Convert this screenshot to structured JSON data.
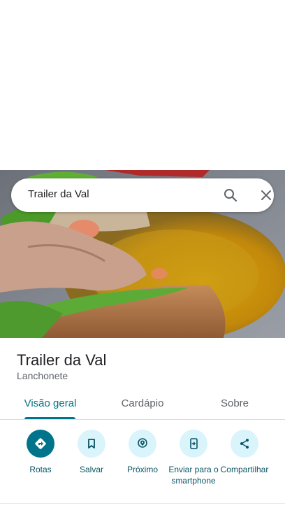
{
  "search": {
    "query": "Trailer da Val"
  },
  "icons": {
    "search": "search-icon",
    "close": "close-icon",
    "directions": "directions-icon",
    "save": "bookmark-icon",
    "nearby": "nearby-pin-icon",
    "send": "send-to-phone-icon",
    "share": "share-icon"
  },
  "place": {
    "title": "Trailer da Val",
    "category": "Lanchonete"
  },
  "tabs": [
    {
      "label": "Visão geral",
      "active": true
    },
    {
      "label": "Cardápio",
      "active": false
    },
    {
      "label": "Sobre",
      "active": false
    }
  ],
  "actions": [
    {
      "label": "Rotas",
      "icon": "directions-icon"
    },
    {
      "label": "Salvar",
      "icon": "bookmark-icon"
    },
    {
      "label": "Próximo",
      "icon": "nearby-pin-icon"
    },
    {
      "label": "Enviar para o smartphone",
      "icon": "send-to-phone-icon"
    },
    {
      "label": "Compartilhar",
      "icon": "share-icon"
    }
  ],
  "colors": {
    "accent": "#00748a",
    "action_bg": "#d9f4fb",
    "action_text": "#0b5565",
    "muted": "#5f6368"
  }
}
